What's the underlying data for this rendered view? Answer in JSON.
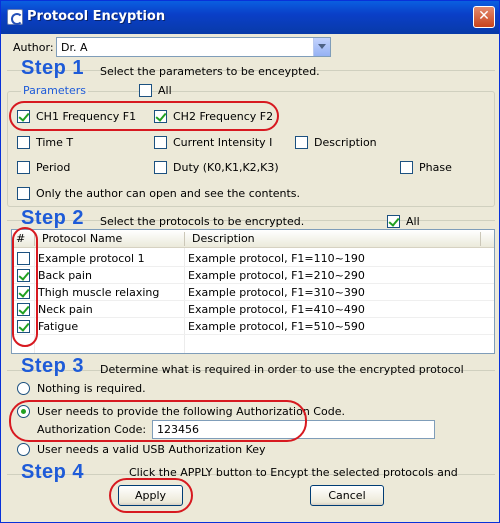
{
  "window": {
    "title": "Protocol Encyption"
  },
  "author": {
    "label": "Author:",
    "value": "Dr. A"
  },
  "step1": {
    "heading": "Step 1",
    "description": "Select the parameters to be enceypted.",
    "group_label": "Parameters",
    "all_label": "All",
    "all_checked": false,
    "params": [
      {
        "label": "CH1 Frequency F1",
        "checked": true
      },
      {
        "label": "CH2 Frequency F2",
        "checked": true
      },
      {
        "label": "Time T",
        "checked": false
      },
      {
        "label": "Current Intensity I",
        "checked": false
      },
      {
        "label": "Description",
        "checked": false
      },
      {
        "label": "Period",
        "checked": false
      },
      {
        "label": "Duty (K0,K1,K2,K3)",
        "checked": false
      },
      {
        "label": "Phase",
        "checked": false
      }
    ],
    "author_only_label": "Only the author can open and see the contents.",
    "author_only_checked": false
  },
  "step2": {
    "heading": "Step 2",
    "description": "Select the protocols to be encrypted.",
    "all_label": "All",
    "all_checked": true,
    "columns": {
      "hash": "#",
      "name": "Protocol Name",
      "description": "Description"
    },
    "rows": [
      {
        "name": "Example protocol 1",
        "description": "Example protocol, F1=110~190",
        "checked": false
      },
      {
        "name": "Back pain",
        "description": "Example protocol, F1=210~290",
        "checked": true
      },
      {
        "name": "Thigh muscle relaxing",
        "description": "Example protocol, F1=310~390",
        "checked": true
      },
      {
        "name": "Neck pain",
        "description": "Example protocol, F1=410~490",
        "checked": true
      },
      {
        "name": "Fatigue",
        "description": "Example protocol, F1=510~590",
        "checked": true
      }
    ]
  },
  "step3": {
    "heading": "Step 3",
    "description": "Determine what is required in order to use the encrypted protocol",
    "options": [
      {
        "label": "Nothing is required.",
        "selected": false
      },
      {
        "label": "User needs to provide the following Authorization Code.",
        "selected": true
      },
      {
        "label": "User needs a valid USB Authorization Key",
        "selected": false
      }
    ],
    "auth_code_label": "Authorization Code:",
    "auth_code_value": "123456"
  },
  "step4": {
    "heading": "Step 4",
    "description": "Click the APPLY button to Encypt the selected protocols and",
    "apply_label": "Apply",
    "cancel_label": "Cancel"
  },
  "icons": {
    "app": "app-icon",
    "close": "close-icon",
    "dropdown": "chevron-down-icon"
  },
  "colors": {
    "step_heading": "#1e5bd8",
    "annotation": "#d71920",
    "check": "#21a121"
  }
}
